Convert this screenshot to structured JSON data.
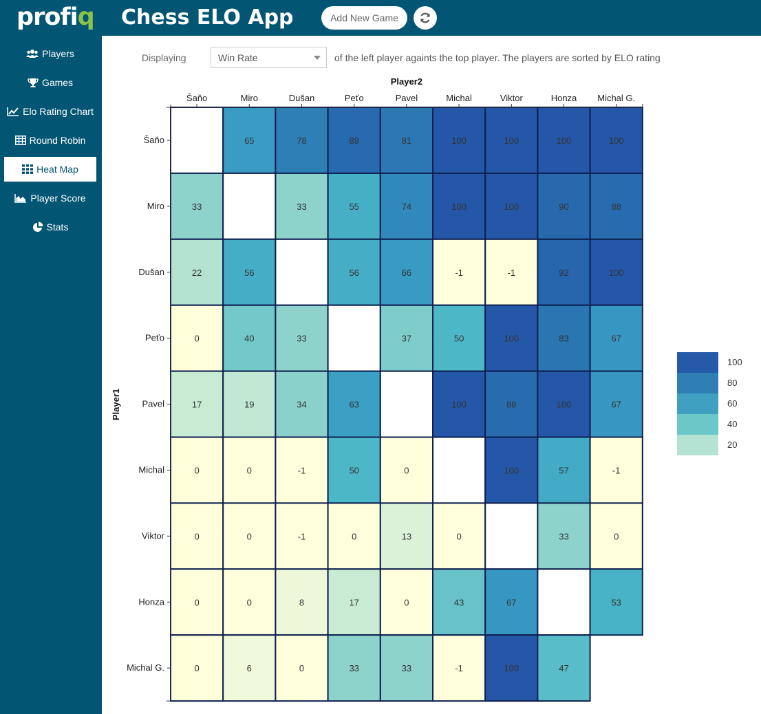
{
  "app": {
    "logo_text_main": "profi",
    "logo_text_accent": "q",
    "title": "Chess ELO App",
    "add_game_label": "Add New Game",
    "refresh_icon": "refresh-icon"
  },
  "sidebar": {
    "items": [
      {
        "label": "Players",
        "icon": "users-icon",
        "active": false
      },
      {
        "label": "Games",
        "icon": "trophy-icon",
        "active": false
      },
      {
        "label": "Elo Rating Chart",
        "icon": "line-chart-icon",
        "active": false
      },
      {
        "label": "Round Robin",
        "icon": "table-icon",
        "active": false
      },
      {
        "label": "Heat Map",
        "icon": "grid-icon",
        "active": true
      },
      {
        "label": "Player Score",
        "icon": "area-chart-icon",
        "active": false
      },
      {
        "label": "Stats",
        "icon": "pie-chart-icon",
        "active": false
      }
    ]
  },
  "controls": {
    "displaying_label": "Displaying",
    "selected_metric": "Win Rate",
    "description": "of the left player againts the top player. The players are sorted by ELO rating"
  },
  "colors": {
    "brand": "#035574",
    "accent": "#8bc34a",
    "cell_border": "#0d1f4f"
  },
  "chart_data": {
    "type": "heatmap",
    "xlabel": "Player2",
    "ylabel": "Player1",
    "x_categories": [
      "Šaňo",
      "Miro",
      "Dušan",
      "Peťo",
      "Pavel",
      "Michal",
      "Viktor",
      "Honza",
      "Michal G."
    ],
    "y_categories": [
      "Šaňo",
      "Miro",
      "Dušan",
      "Peťo",
      "Pavel",
      "Michal",
      "Viktor",
      "Honza",
      "Michal G."
    ],
    "values": [
      [
        null,
        65,
        78,
        89,
        81,
        100,
        100,
        100,
        100
      ],
      [
        33,
        null,
        33,
        55,
        74,
        100,
        100,
        90,
        88
      ],
      [
        22,
        56,
        null,
        56,
        66,
        -1,
        -1,
        92,
        100
      ],
      [
        0,
        40,
        33,
        null,
        37,
        50,
        100,
        83,
        67
      ],
      [
        17,
        19,
        34,
        63,
        null,
        100,
        88,
        100,
        67
      ],
      [
        0,
        0,
        -1,
        50,
        0,
        null,
        100,
        57,
        -1
      ],
      [
        0,
        0,
        -1,
        0,
        13,
        0,
        null,
        33,
        0
      ],
      [
        0,
        0,
        8,
        17,
        0,
        43,
        67,
        null,
        53
      ],
      [
        0,
        6,
        0,
        33,
        33,
        -1,
        100,
        47,
        null
      ]
    ],
    "legend": [
      {
        "label": "100",
        "color": "#245aa8"
      },
      {
        "label": "80",
        "color": "#2f7eb4"
      },
      {
        "label": "60",
        "color": "#3fa0c2"
      },
      {
        "label": "40",
        "color": "#6cc7c8"
      },
      {
        "label": "20",
        "color": "#b4e3d4"
      }
    ]
  }
}
